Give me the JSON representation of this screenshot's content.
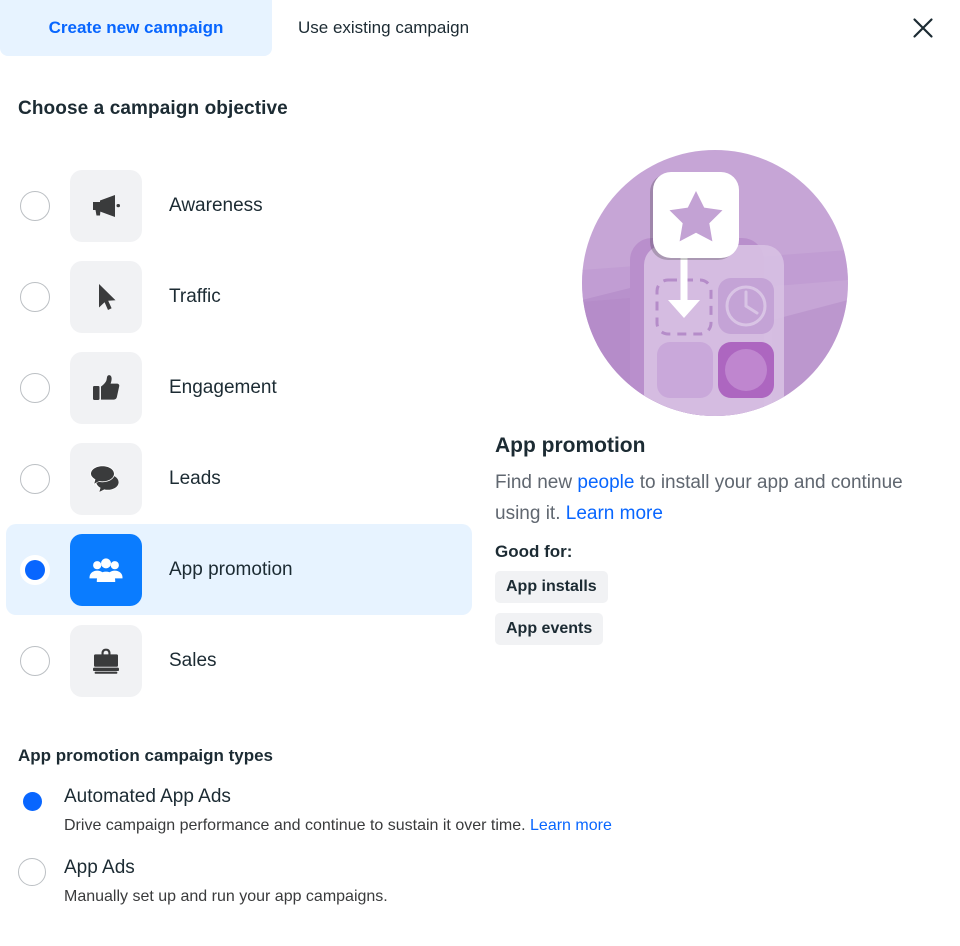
{
  "tabs": [
    {
      "label": "Create new campaign",
      "active": true
    },
    {
      "label": "Use existing campaign",
      "active": false
    }
  ],
  "close_icon": "close-icon",
  "section": {
    "title": "Choose a campaign objective"
  },
  "objectives": [
    {
      "label": "Awareness",
      "icon": "megaphone-icon",
      "selected": false
    },
    {
      "label": "Traffic",
      "icon": "cursor-icon",
      "selected": false
    },
    {
      "label": "Engagement",
      "icon": "thumbs-up-icon",
      "selected": false
    },
    {
      "label": "Leads",
      "icon": "chat-bubbles-icon",
      "selected": false
    },
    {
      "label": "App promotion",
      "icon": "people-group-icon",
      "selected": true
    },
    {
      "label": "Sales",
      "icon": "briefcase-icon",
      "selected": false
    }
  ],
  "detail": {
    "illustration": "app-promotion-illustration",
    "title": "App promotion",
    "desc_part1": "Find new ",
    "desc_link1": "people",
    "desc_part2": " to install your app and continue using it. ",
    "desc_link2": "Learn more",
    "good_for_label": "Good for:",
    "chips": [
      "App installs",
      "App events"
    ]
  },
  "campaign_types": {
    "title": "App promotion campaign types",
    "options": [
      {
        "label": "Automated App Ads",
        "desc": "Drive campaign performance and continue to sustain it over time. ",
        "link": "Learn more",
        "selected": true
      },
      {
        "label": "App Ads",
        "desc": "Manually set up and run your app campaigns.",
        "link": "",
        "selected": false
      }
    ]
  },
  "colors": {
    "accent_blue": "#0866ff",
    "tile_blue": "#0a7cff",
    "highlight_blue": "#e7f3ff",
    "tile_gray": "#f1f2f4",
    "text_dark": "#1c2b33",
    "text_muted": "#606770",
    "illustration_purple": "#bf9dd0"
  }
}
